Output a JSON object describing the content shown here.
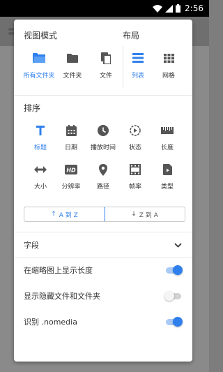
{
  "status_bar": {
    "time": "2:56"
  },
  "view_mode": {
    "title": "视图模式",
    "options": [
      {
        "label": "所有文件夹",
        "icon": "folder-open-icon",
        "active": true
      },
      {
        "label": "文件夹",
        "icon": "folder-icon",
        "active": false
      },
      {
        "label": "文件",
        "icon": "file-copy-icon",
        "active": false
      }
    ]
  },
  "layout": {
    "title": "布局",
    "options": [
      {
        "label": "列表",
        "icon": "list-icon",
        "active": true
      },
      {
        "label": "网格",
        "icon": "grid-icon",
        "active": false
      }
    ]
  },
  "sort": {
    "title": "排序",
    "options": [
      {
        "label": "标题",
        "icon": "title-T-icon",
        "active": true
      },
      {
        "label": "日期",
        "icon": "calendar-icon",
        "active": false
      },
      {
        "label": "播放时间",
        "icon": "clock-icon",
        "active": false
      },
      {
        "label": "状态",
        "icon": "play-status-icon",
        "active": false
      },
      {
        "label": "长度",
        "icon": "ruler-icon",
        "active": false
      },
      {
        "label": "大小",
        "icon": "arrows-horizontal-icon",
        "active": false
      },
      {
        "label": "分辨率",
        "icon": "hd-icon",
        "active": false
      },
      {
        "label": "路径",
        "icon": "location-pin-icon",
        "active": false
      },
      {
        "label": "帧率",
        "icon": "film-icon",
        "active": false
      },
      {
        "label": "类型",
        "icon": "file-play-icon",
        "active": false
      }
    ],
    "order_asc": "A 到 Z",
    "order_desc": "Z 到 A"
  },
  "fields": {
    "title": "字段"
  },
  "settings": [
    {
      "label": "在缩略图上显示长度",
      "on": true
    },
    {
      "label": "显示隐藏文件和文件夹",
      "on": false
    },
    {
      "label": "识别 .nomedia",
      "on": true
    }
  ],
  "colors": {
    "accent": "#2f80ed",
    "icon": "#555555"
  }
}
